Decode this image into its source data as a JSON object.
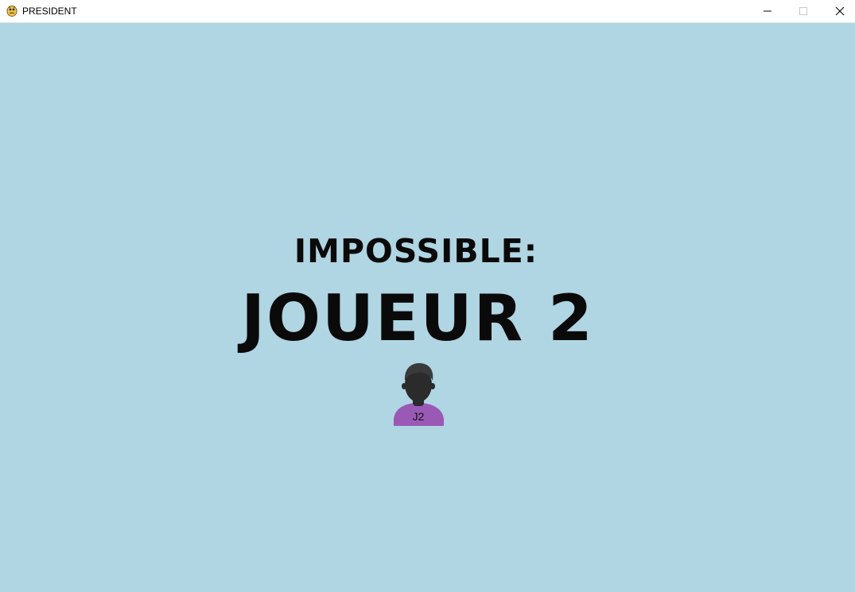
{
  "window": {
    "title": "PRESIDENT",
    "icon": "python-snake-icon"
  },
  "controls": {
    "minimize_icon": "minimize-icon",
    "maximize_icon": "maximize-icon",
    "close_icon": "close-icon"
  },
  "screen": {
    "background_color": "#b0d5e3",
    "subtitle": "IMPOSSIBLE:",
    "player_name": "JOUEUR 2",
    "avatar": {
      "icon": "person-avatar-icon",
      "label": "J2",
      "shirt_color": "#9b59b6",
      "head_color": "#2b2b2b"
    }
  }
}
